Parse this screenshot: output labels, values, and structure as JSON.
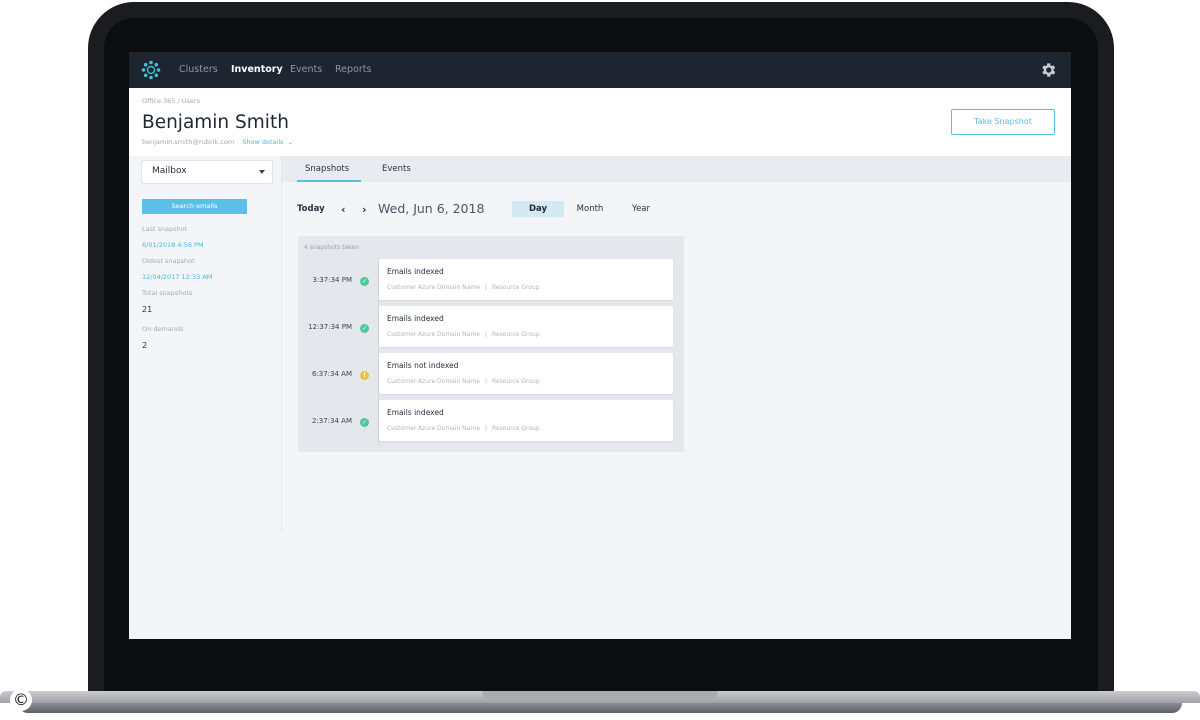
{
  "nav": {
    "items": [
      {
        "label": "Clusters",
        "active": false
      },
      {
        "label": "Inventory",
        "active": true
      },
      {
        "label": "Events",
        "active": false
      },
      {
        "label": "Reports",
        "active": false
      }
    ],
    "settings_icon": "gear-icon",
    "logo_icon": "rubrik-logo-icon"
  },
  "header": {
    "breadcrumb": "Office 365 / Users",
    "title": "Benjamin Smith",
    "email": "benjamin.smith@rubrik.com",
    "show_details": "Show details",
    "snapshot_button": "Take Snapshot"
  },
  "sidebar": {
    "select_value": "Mailbox",
    "search_button": "Search emails",
    "stats": [
      {
        "label": "Last snapshot",
        "value": "6/01/2018 4:56 PM",
        "kind": "link"
      },
      {
        "label": "Oldest snapshot",
        "value": "12/04/2017 12:33 AM",
        "kind": "link"
      },
      {
        "label": "Total snapshots",
        "value": "21",
        "kind": "value"
      },
      {
        "label": "On demands",
        "value": "2",
        "kind": "value"
      }
    ]
  },
  "tabs": [
    {
      "label": "Snapshots",
      "active": true
    },
    {
      "label": "Events",
      "active": false
    }
  ],
  "datebar": {
    "today": "Today",
    "prev": "‹",
    "next": "›",
    "date": "Wed, Jun 6, 2018",
    "ranges": [
      {
        "label": "Day",
        "active": true
      },
      {
        "label": "Month",
        "active": false
      },
      {
        "label": "Year",
        "active": false
      }
    ]
  },
  "timeline": {
    "count_label": "4 snapshots taken",
    "rows": [
      {
        "time": "3:37:34 PM",
        "status": "success",
        "title": "Emails indexed",
        "meta1": "Customer Azure Domain Name",
        "meta2": "Resource Group"
      },
      {
        "time": "12:37:34 PM",
        "status": "success",
        "title": "Emails indexed",
        "meta1": "Customer Azure Domain Name",
        "meta2": "Resource Group"
      },
      {
        "time": "6:37:34 AM",
        "status": "warning",
        "title": "Emails not indexed",
        "meta1": "Customer Azure Domain Name",
        "meta2": "Resource Group"
      },
      {
        "time": "2:37:34 AM",
        "status": "success",
        "title": "Emails indexed",
        "meta1": "Customer Azure Domain Name",
        "meta2": "Resource Group"
      }
    ]
  },
  "colors": {
    "accent": "#58bfe3",
    "success": "#4fc99b",
    "warning": "#f2c037",
    "nav_bg": "#1e2430"
  },
  "copyright_mark": "©"
}
